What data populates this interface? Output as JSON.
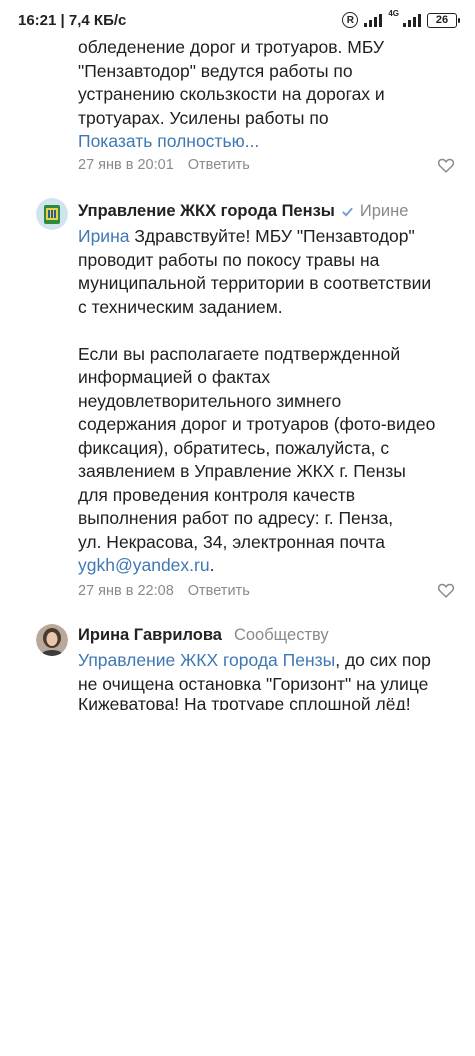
{
  "status_bar": {
    "time_speed": "16:21 | 7,4 КБ/с",
    "r_icon": "R",
    "network": "4G",
    "battery": "26"
  },
  "comment1": {
    "line1": "обледенение дорог и тротуаров. МБУ",
    "line2": "\"Пензавтодор\" ведутся работы по",
    "line3": "устранению скользкости на дорогах и",
    "line4": "тротуарах. Усилены работы по",
    "show_more": "Показать полностью...",
    "time": "27 янв в 20:01",
    "reply": "Ответить"
  },
  "comment2": {
    "author": "Управление ЖКХ города Пензы",
    "recipient": "Ирине",
    "mention": "Ирина",
    "p1_l1": "Здравствуйте! МБУ \"Пензавтодор\"",
    "p1_l2": "проводит работы по покосу травы на",
    "p1_l3": "муниципальной территории в соответствии",
    "p1_l4": "с техническим заданием.",
    "p2_l1": "Если вы располагаете подтвержденной",
    "p2_l2": "информацией о фактах",
    "p2_l3": "неудовлетворительного зимнего",
    "p2_l4": "содержания дорог и тротуаров (фото-видео",
    "p2_l5": "фиксация), обратитесь, пожалуйста, с",
    "p2_l6": "заявлением в Управление ЖКХ г. Пензы",
    "p2_l7": "для проведения контроля качеств",
    "p2_l8": "выполнения работ по адресу: г. Пенза,",
    "p2_l9": "ул. Некрасова, 34, электронная почта",
    "email": "ygkh@yandex.ru",
    "email_tail": ".",
    "time": "27 янв в 22:08",
    "reply": "Ответить"
  },
  "comment3": {
    "author": "Ирина Гаврилова",
    "recipient": "Сообществу",
    "mention": "Управление ЖКХ города Пензы",
    "l1_tail": ", до сих пор",
    "l2": "не очищена остановка \"Горизонт\" на улице",
    "l3_partial": "Кижеватова! На тротуаре сплошной лёд!"
  },
  "colors": {
    "link": "#3f78b4",
    "meta": "#8a8a8a",
    "text": "#1f1f1f"
  }
}
